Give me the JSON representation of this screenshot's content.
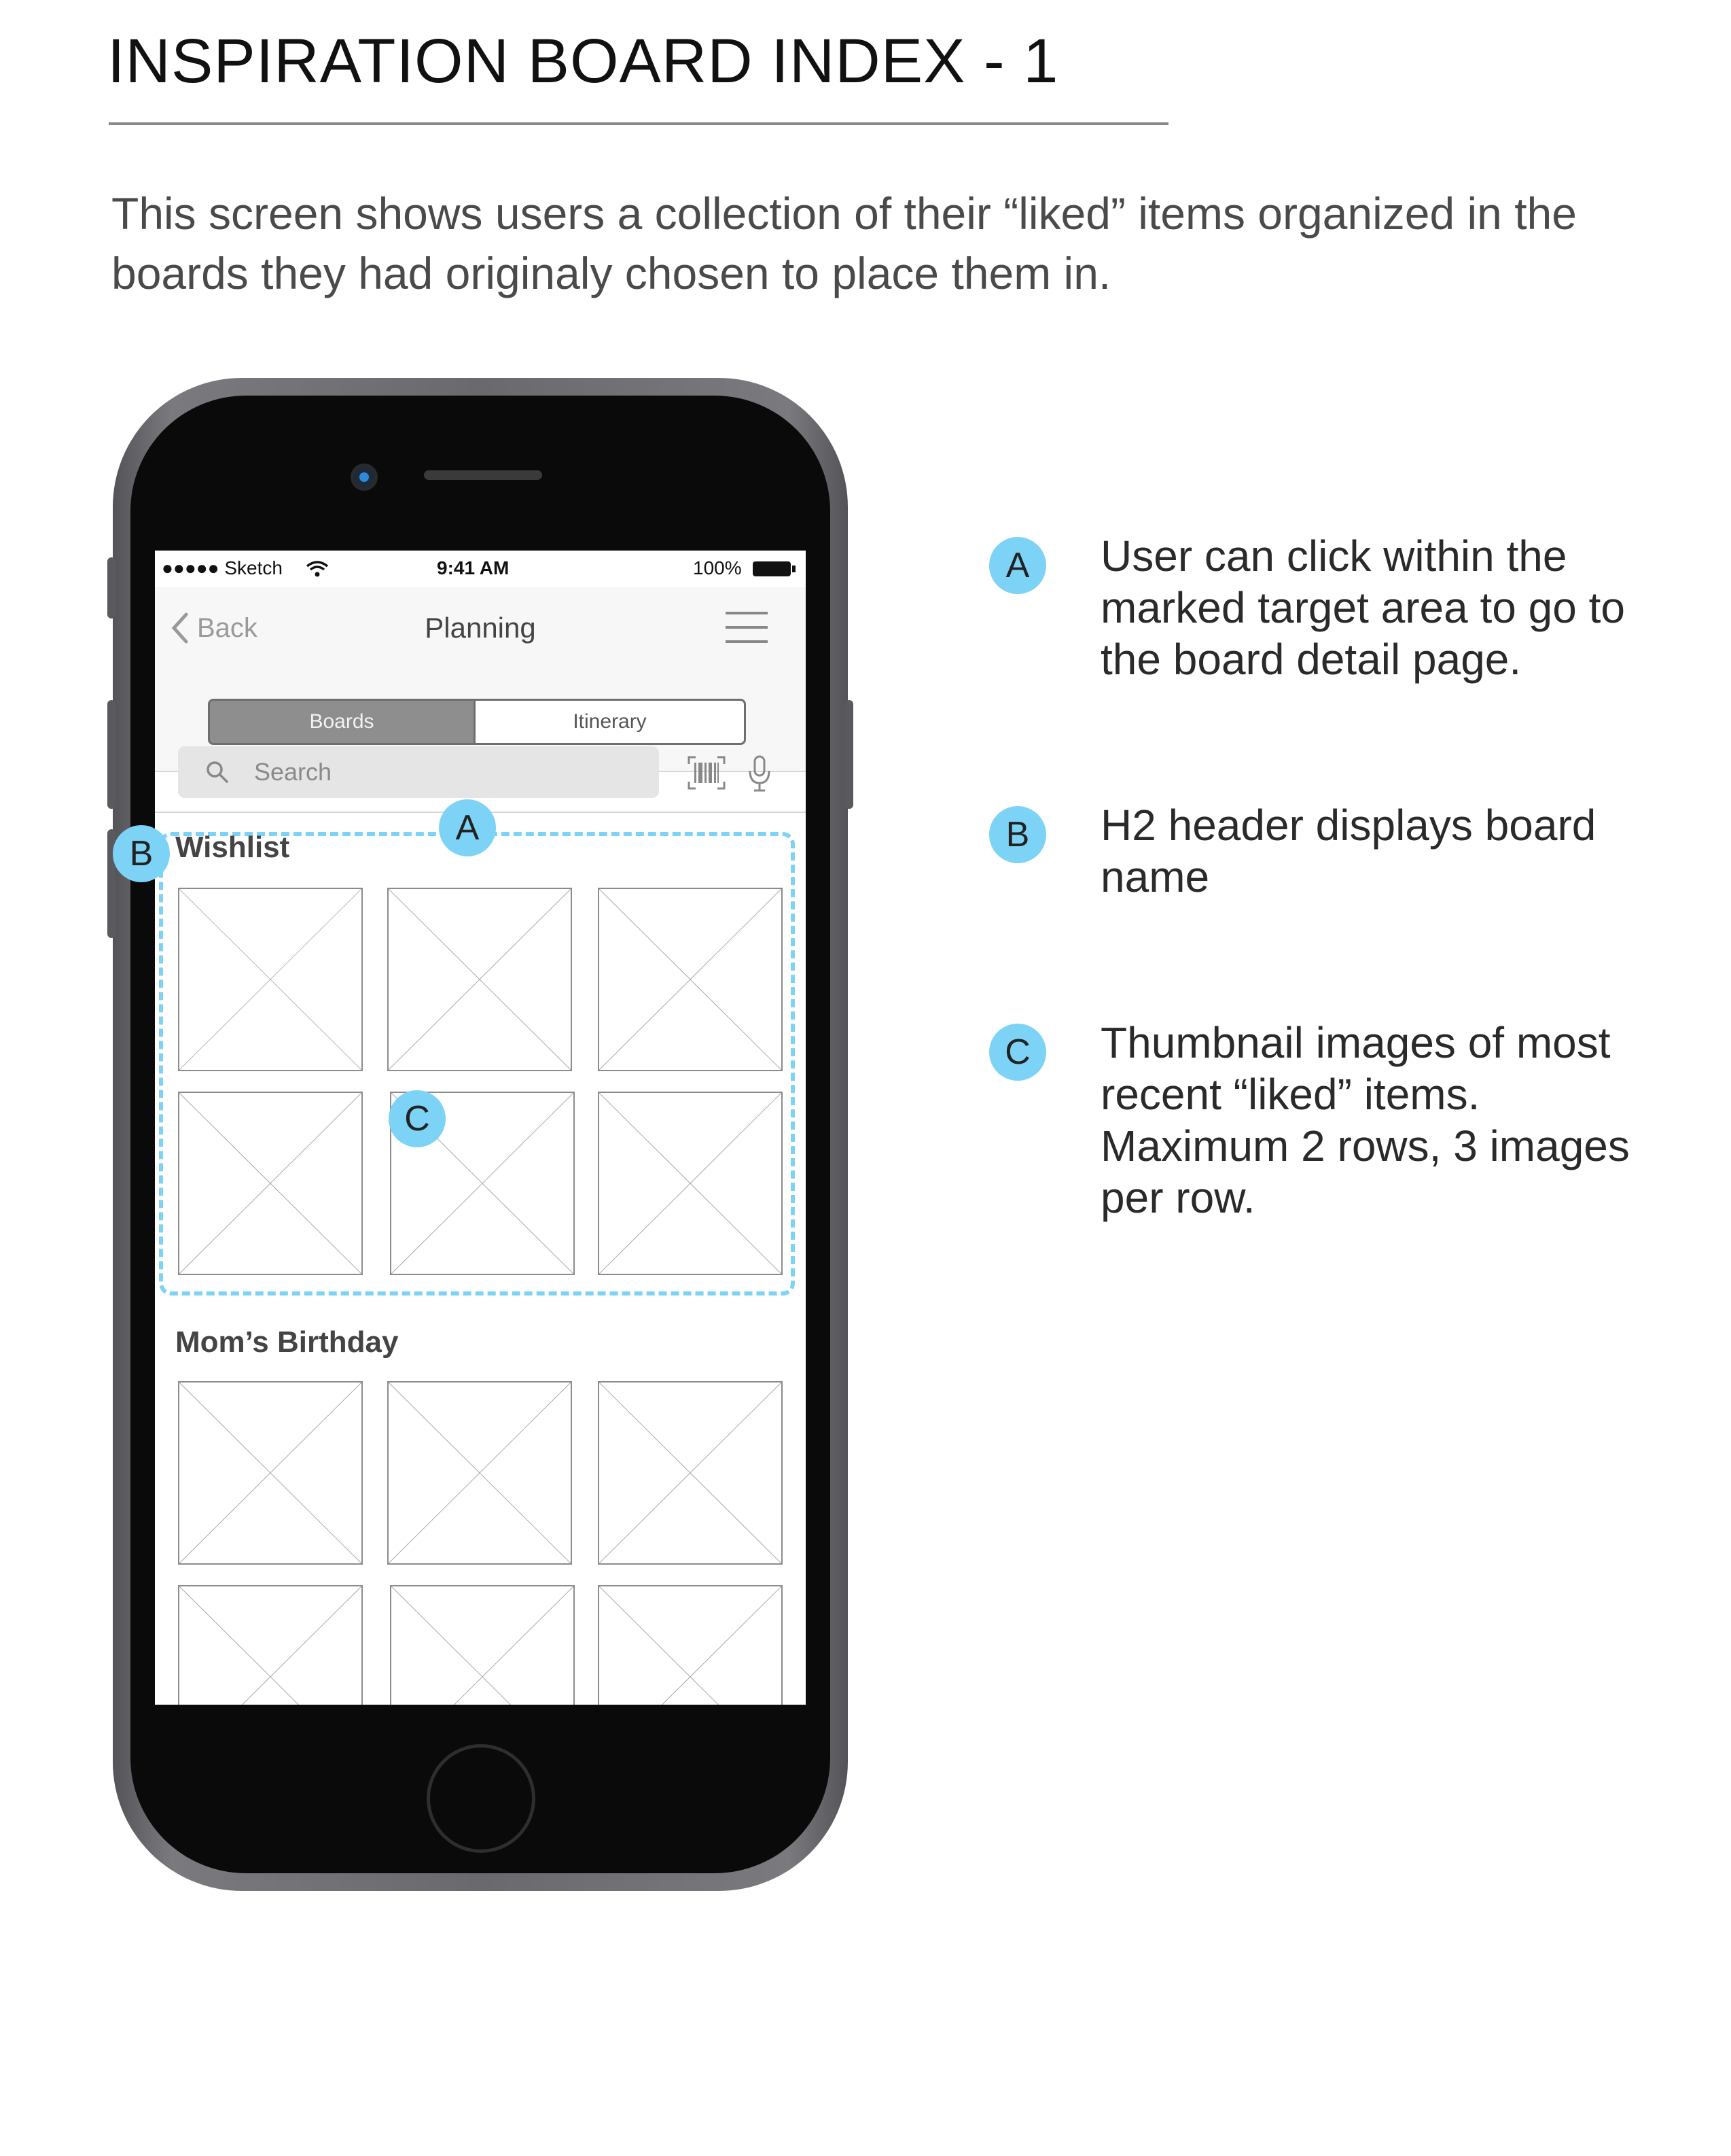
{
  "document": {
    "title": "INSPIRATION BOARD INDEX - 1",
    "intro": "This screen shows users a collection of their “liked” items organized in the boards they had originaly chosen to place them in."
  },
  "status_bar": {
    "carrier": "●●●●● Sketch",
    "time": "9:41 AM",
    "battery": "100%"
  },
  "nav": {
    "back_label": "Back",
    "title": "Planning"
  },
  "segments": [
    {
      "label": "Boards",
      "selected": true
    },
    {
      "label": "Itinerary",
      "selected": false
    }
  ],
  "search": {
    "placeholder": "Search"
  },
  "boards": [
    {
      "name": "Wishlist"
    },
    {
      "name": "Mom’s Birthday"
    }
  ],
  "annotations": [
    {
      "marker": "A",
      "text": "User can click within the marked target area to go to the board detail page."
    },
    {
      "marker": "B",
      "text": "H2 header displays board name"
    },
    {
      "marker": "C",
      "text": "Thumbnail images of most recent “liked” items. Maximum 2 rows, 3 images per row."
    }
  ],
  "colors": {
    "marker": "#7cd3f5",
    "dash": "#7cd3f5",
    "segment_selected": "#8e8e8e"
  }
}
